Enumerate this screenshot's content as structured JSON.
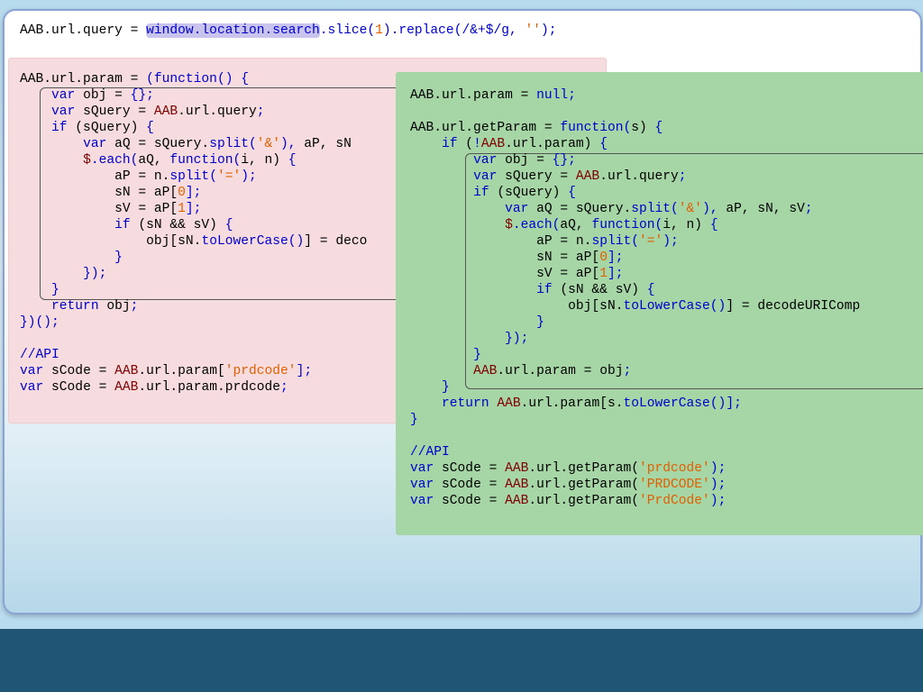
{
  "top_line": [
    {
      "t": "AAB.url.query = ",
      "c": ""
    },
    {
      "t": "window.location.search",
      "c": "hl pu"
    },
    {
      "t": ".slice(",
      "c": "pu"
    },
    {
      "t": "1",
      "c": "num"
    },
    {
      "t": ").replace(/&+$/g, ",
      "c": "pu"
    },
    {
      "t": "''",
      "c": "str"
    },
    {
      "t": ");",
      "c": "pu"
    }
  ],
  "pink_code": [
    [
      {
        "t": "AAB.url.param = ",
        "c": ""
      },
      {
        "t": "(function() {",
        "c": "kw"
      }
    ],
    [
      {
        "t": "    ",
        "c": ""
      },
      {
        "t": "var",
        "c": "kw"
      },
      {
        "t": " obj = ",
        "c": ""
      },
      {
        "t": "{};",
        "c": "pu"
      }
    ],
    [
      {
        "t": "    ",
        "c": ""
      },
      {
        "t": "var",
        "c": "kw"
      },
      {
        "t": " sQuery = ",
        "c": ""
      },
      {
        "t": "AAB",
        "c": "rd"
      },
      {
        "t": ".url.query",
        "c": ""
      },
      {
        "t": ";",
        "c": "pu"
      }
    ],
    [
      {
        "t": "    ",
        "c": ""
      },
      {
        "t": "if",
        "c": "kw"
      },
      {
        "t": " (sQuery) ",
        "c": ""
      },
      {
        "t": "{",
        "c": "pu"
      }
    ],
    [
      {
        "t": "        ",
        "c": ""
      },
      {
        "t": "var",
        "c": "kw"
      },
      {
        "t": " aQ = sQuery.",
        "c": ""
      },
      {
        "t": "split(",
        "c": "pu"
      },
      {
        "t": "'&'",
        "c": "str"
      },
      {
        "t": "),",
        "c": "pu"
      },
      {
        "t": " aP, sN",
        "c": ""
      }
    ],
    [
      {
        "t": "        ",
        "c": ""
      },
      {
        "t": "$",
        "c": "rd"
      },
      {
        "t": ".each(",
        "c": "pu"
      },
      {
        "t": "aQ, ",
        "c": ""
      },
      {
        "t": "function(",
        "c": "kw"
      },
      {
        "t": "i, n) ",
        "c": ""
      },
      {
        "t": "{",
        "c": "pu"
      }
    ],
    [
      {
        "t": "            aP = n.",
        "c": ""
      },
      {
        "t": "split(",
        "c": "pu"
      },
      {
        "t": "'='",
        "c": "str"
      },
      {
        "t": ");",
        "c": "pu"
      }
    ],
    [
      {
        "t": "            sN = aP[",
        "c": ""
      },
      {
        "t": "0",
        "c": "num"
      },
      {
        "t": "];",
        "c": "pu"
      }
    ],
    [
      {
        "t": "            sV = aP[",
        "c": ""
      },
      {
        "t": "1",
        "c": "num"
      },
      {
        "t": "];",
        "c": "pu"
      }
    ],
    [
      {
        "t": "            ",
        "c": ""
      },
      {
        "t": "if",
        "c": "kw"
      },
      {
        "t": " (sN && sV) ",
        "c": ""
      },
      {
        "t": "{",
        "c": "pu"
      }
    ],
    [
      {
        "t": "                obj[sN.",
        "c": ""
      },
      {
        "t": "toLowerCase()",
        "c": "pu"
      },
      {
        "t": "] = deco",
        "c": ""
      }
    ],
    [
      {
        "t": "            ",
        "c": ""
      },
      {
        "t": "}",
        "c": "pu"
      }
    ],
    [
      {
        "t": "        ",
        "c": ""
      },
      {
        "t": "});",
        "c": "pu"
      }
    ],
    [
      {
        "t": "    ",
        "c": ""
      },
      {
        "t": "}",
        "c": "pu"
      }
    ],
    [
      {
        "t": "    ",
        "c": ""
      },
      {
        "t": "return",
        "c": "kw"
      },
      {
        "t": " obj",
        "c": ""
      },
      {
        "t": ";",
        "c": "pu"
      }
    ],
    [
      {
        "t": "})();",
        "c": "pu"
      }
    ],
    [
      {
        "t": "",
        "c": ""
      }
    ],
    [
      {
        "t": "//API",
        "c": "cm"
      }
    ],
    [
      {
        "t": "var",
        "c": "kw"
      },
      {
        "t": " sCode = ",
        "c": ""
      },
      {
        "t": "AAB",
        "c": "rd"
      },
      {
        "t": ".url.param[",
        "c": ""
      },
      {
        "t": "'prdcode'",
        "c": "str"
      },
      {
        "t": "];",
        "c": "pu"
      }
    ],
    [
      {
        "t": "var",
        "c": "kw"
      },
      {
        "t": " sCode = ",
        "c": ""
      },
      {
        "t": "AAB",
        "c": "rd"
      },
      {
        "t": ".url.param.prdcode",
        "c": ""
      },
      {
        "t": ";",
        "c": "pu"
      }
    ]
  ],
  "green_code": [
    [
      {
        "t": "AAB.url.param = ",
        "c": ""
      },
      {
        "t": "null;",
        "c": "kw"
      }
    ],
    [
      {
        "t": "",
        "c": ""
      }
    ],
    [
      {
        "t": "AAB.url.getParam = ",
        "c": ""
      },
      {
        "t": "function(",
        "c": "kw"
      },
      {
        "t": "s) ",
        "c": ""
      },
      {
        "t": "{",
        "c": "pu"
      }
    ],
    [
      {
        "t": "    ",
        "c": ""
      },
      {
        "t": "if",
        "c": "kw"
      },
      {
        "t": " (",
        "c": ""
      },
      {
        "t": "!",
        "c": "pu"
      },
      {
        "t": "AAB",
        "c": "rd"
      },
      {
        "t": ".url.param) ",
        "c": ""
      },
      {
        "t": "{",
        "c": "pu"
      }
    ],
    [
      {
        "t": "        ",
        "c": ""
      },
      {
        "t": "var",
        "c": "kw"
      },
      {
        "t": " obj = ",
        "c": ""
      },
      {
        "t": "{};",
        "c": "pu"
      }
    ],
    [
      {
        "t": "        ",
        "c": ""
      },
      {
        "t": "var",
        "c": "kw"
      },
      {
        "t": " sQuery = ",
        "c": ""
      },
      {
        "t": "AAB",
        "c": "rd"
      },
      {
        "t": ".url.query",
        "c": ""
      },
      {
        "t": ";",
        "c": "pu"
      }
    ],
    [
      {
        "t": "        ",
        "c": ""
      },
      {
        "t": "if",
        "c": "kw"
      },
      {
        "t": " (sQuery) ",
        "c": ""
      },
      {
        "t": "{",
        "c": "pu"
      }
    ],
    [
      {
        "t": "            ",
        "c": ""
      },
      {
        "t": "var",
        "c": "kw"
      },
      {
        "t": " aQ = sQuery.",
        "c": ""
      },
      {
        "t": "split(",
        "c": "pu"
      },
      {
        "t": "'&'",
        "c": "str"
      },
      {
        "t": "),",
        "c": "pu"
      },
      {
        "t": " aP, sN, sV",
        "c": ""
      },
      {
        "t": ";",
        "c": "pu"
      }
    ],
    [
      {
        "t": "            ",
        "c": ""
      },
      {
        "t": "$",
        "c": "rd"
      },
      {
        "t": ".each(",
        "c": "pu"
      },
      {
        "t": "aQ, ",
        "c": ""
      },
      {
        "t": "function(",
        "c": "kw"
      },
      {
        "t": "i, n) ",
        "c": ""
      },
      {
        "t": "{",
        "c": "pu"
      }
    ],
    [
      {
        "t": "                aP = n.",
        "c": ""
      },
      {
        "t": "split(",
        "c": "pu"
      },
      {
        "t": "'='",
        "c": "str"
      },
      {
        "t": ");",
        "c": "pu"
      }
    ],
    [
      {
        "t": "                sN = aP[",
        "c": ""
      },
      {
        "t": "0",
        "c": "num"
      },
      {
        "t": "];",
        "c": "pu"
      }
    ],
    [
      {
        "t": "                sV = aP[",
        "c": ""
      },
      {
        "t": "1",
        "c": "num"
      },
      {
        "t": "];",
        "c": "pu"
      }
    ],
    [
      {
        "t": "                ",
        "c": ""
      },
      {
        "t": "if",
        "c": "kw"
      },
      {
        "t": " (sN && sV) ",
        "c": ""
      },
      {
        "t": "{",
        "c": "pu"
      }
    ],
    [
      {
        "t": "                    obj[sN.",
        "c": ""
      },
      {
        "t": "toLowerCase()",
        "c": "pu"
      },
      {
        "t": "] = decodeURIComp",
        "c": ""
      }
    ],
    [
      {
        "t": "                ",
        "c": ""
      },
      {
        "t": "}",
        "c": "pu"
      }
    ],
    [
      {
        "t": "            ",
        "c": ""
      },
      {
        "t": "});",
        "c": "pu"
      }
    ],
    [
      {
        "t": "        ",
        "c": ""
      },
      {
        "t": "}",
        "c": "pu"
      }
    ],
    [
      {
        "t": "        ",
        "c": ""
      },
      {
        "t": "AAB",
        "c": "rd"
      },
      {
        "t": ".url.param = obj",
        "c": ""
      },
      {
        "t": ";",
        "c": "pu"
      }
    ],
    [
      {
        "t": "    ",
        "c": ""
      },
      {
        "t": "}",
        "c": "pu"
      }
    ],
    [
      {
        "t": "    ",
        "c": ""
      },
      {
        "t": "return",
        "c": "kw"
      },
      {
        "t": " ",
        "c": ""
      },
      {
        "t": "AAB",
        "c": "rd"
      },
      {
        "t": ".url.param[s.",
        "c": ""
      },
      {
        "t": "toLowerCase()",
        "c": "pu"
      },
      {
        "t": "];",
        "c": "pu"
      }
    ],
    [
      {
        "t": "}",
        "c": "pu"
      }
    ],
    [
      {
        "t": "",
        "c": ""
      }
    ],
    [
      {
        "t": "//API",
        "c": "cm"
      }
    ],
    [
      {
        "t": "var",
        "c": "kw"
      },
      {
        "t": " sCode = ",
        "c": ""
      },
      {
        "t": "AAB",
        "c": "rd"
      },
      {
        "t": ".url.getParam(",
        "c": ""
      },
      {
        "t": "'prdcode'",
        "c": "str"
      },
      {
        "t": ");",
        "c": "pu"
      }
    ],
    [
      {
        "t": "var",
        "c": "kw"
      },
      {
        "t": " sCode = ",
        "c": ""
      },
      {
        "t": "AAB",
        "c": "rd"
      },
      {
        "t": ".url.getParam(",
        "c": ""
      },
      {
        "t": "'PRDCODE'",
        "c": "str"
      },
      {
        "t": ");",
        "c": "pu"
      }
    ],
    [
      {
        "t": "var",
        "c": "kw"
      },
      {
        "t": " sCode = ",
        "c": ""
      },
      {
        "t": "AAB",
        "c": "rd"
      },
      {
        "t": ".url.getParam(",
        "c": ""
      },
      {
        "t": "'PrdCode'",
        "c": "str"
      },
      {
        "t": ");",
        "c": "pu"
      }
    ]
  ],
  "colors": {
    "keyword": "#0000cc",
    "object": "#800000",
    "string": "#e06000",
    "pink_panel": "#f6dcde",
    "green_panel": "#a6d5a6",
    "highlight": "#c9c4ee",
    "bottom_band": "#215575"
  }
}
